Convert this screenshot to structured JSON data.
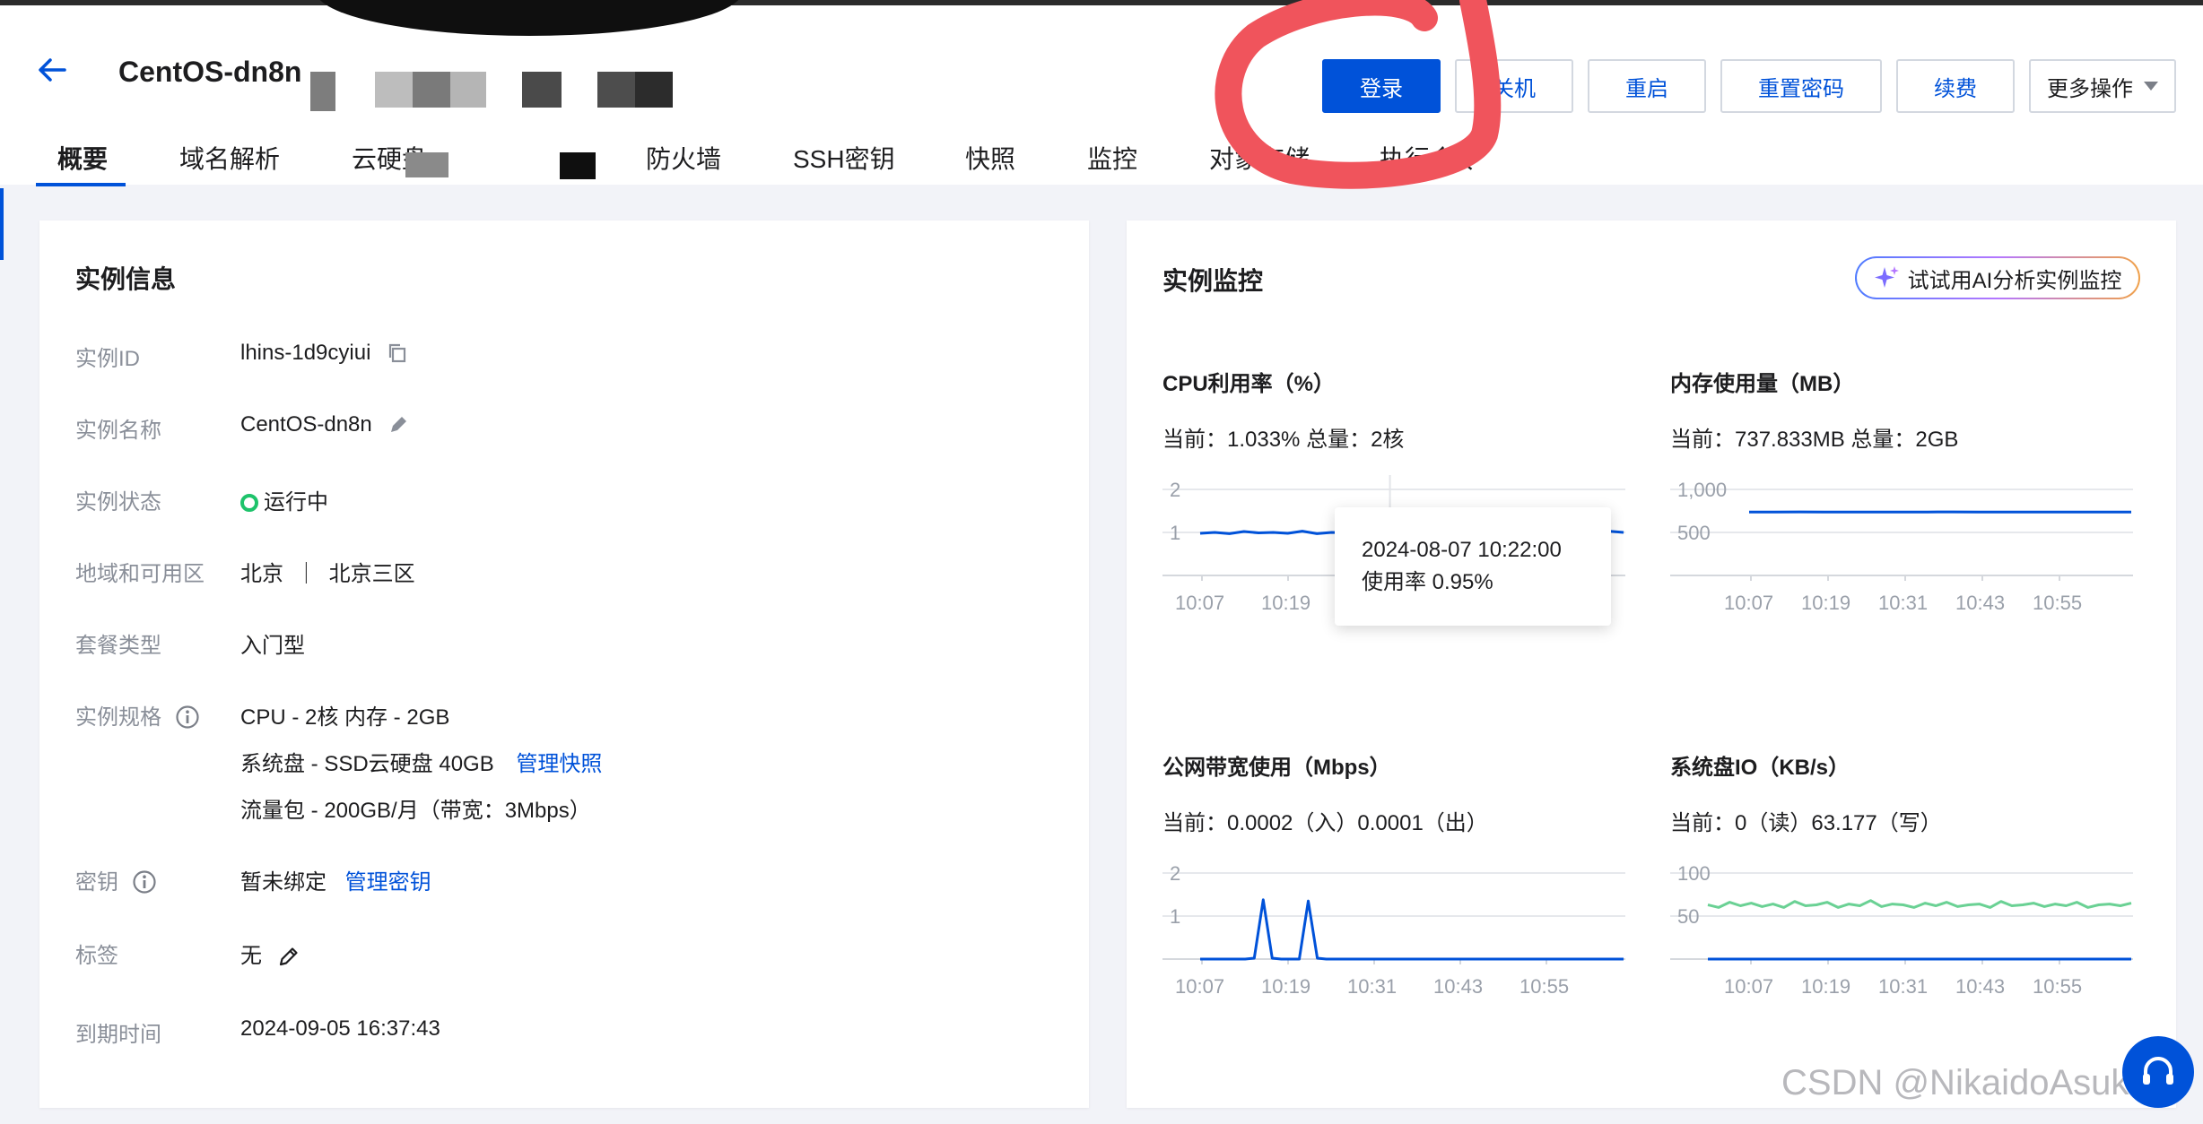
{
  "header": {
    "title": "CentOS-dn8n",
    "buttons": {
      "login": "登录",
      "shutdown": "关机",
      "restart": "重启",
      "reset_password": "重置密码",
      "renew": "续费",
      "more": "更多操作"
    }
  },
  "tabs": [
    {
      "label": "概要"
    },
    {
      "label": "域名解析"
    },
    {
      "label": "云硬盘"
    },
    {
      "label": "防火墙"
    },
    {
      "label": "SSH密钥"
    },
    {
      "label": "快照"
    },
    {
      "label": "监控"
    },
    {
      "label": "对象存储"
    },
    {
      "label": "执行命令"
    }
  ],
  "instance_info": {
    "title": "实例信息",
    "id_label": "实例ID",
    "id_value": "lhins-1d9cyiui",
    "name_label": "实例名称",
    "name_value": "CentOS-dn8n",
    "status_label": "实例状态",
    "status_value": "运行中",
    "region_label": "地域和可用区",
    "region_value": "北京  ｜  北京三区",
    "package_label": "套餐类型",
    "package_value": "入门型",
    "spec_label": "实例规格",
    "spec_cpu": "CPU - 2核 内存 - 2GB",
    "spec_disk": "系统盘 - SSD云硬盘 40GB",
    "spec_disk_link": "管理快照",
    "spec_traffic": "流量包 - 200GB/月（带宽：3Mbps）",
    "key_label": "密钥",
    "key_value": "暂未绑定",
    "key_link": "管理密钥",
    "tag_label": "标签",
    "tag_value": "无",
    "expire_label": "到期时间",
    "expire_value": "2024-09-05 16:37:43"
  },
  "monitor": {
    "title": "实例监控",
    "ai_button": "试试用AI分析实例监控",
    "tooltip_time": "2024-08-07 10:22:00",
    "tooltip_value": "使用率 0.95%",
    "charts": [
      {
        "title": "CPU利用率（%）",
        "current": "当前：1.033% 总量：2核"
      },
      {
        "title": "内存使用量（MB）",
        "current": "当前：737.833MB 总量：2GB"
      },
      {
        "title": "公网带宽使用（Mbps）",
        "current": "当前：0.0002（入）0.0001（出）"
      },
      {
        "title": "系统盘IO（KB/s）",
        "current": "当前：0（读）63.177（写）"
      }
    ]
  },
  "watermark": "CSDN @NikaidoAsuka",
  "colors": {
    "primary": "#0052d9",
    "running": "#1ec36b",
    "io_write": "#6ad194",
    "scribble": "#f0545c"
  },
  "chart_data": [
    {
      "type": "line",
      "yticks": [
        "2",
        "1"
      ],
      "ylim": [
        0,
        2
      ],
      "x_ticks": [
        "10:07",
        "10:19",
        "10:31",
        "10:43",
        "10:55"
      ],
      "series": [
        {
          "values": [
            0.98,
            1.0,
            0.97,
            1.02,
            0.99,
            1.0,
            0.98,
            1.03,
            0.97,
            1.0,
            0.99,
            1.02,
            0.98,
            0.95,
            0.99,
            0.98,
            1.01,
            0.97,
            1.0,
            0.99,
            1.02,
            0.98,
            1.0,
            0.99,
            1.01,
            0.98,
            1.0,
            0.99,
            1.03,
            1.0
          ]
        }
      ]
    },
    {
      "type": "line",
      "yticks": [
        "1,000",
        "500"
      ],
      "ylim": [
        0,
        1000
      ],
      "x_ticks": [
        "10:07",
        "10:19",
        "10:31",
        "10:43",
        "10:55"
      ],
      "series": [
        {
          "values": [
            738,
            738,
            739,
            738,
            738,
            737,
            738,
            738,
            739,
            738,
            738,
            738,
            737,
            738,
            738,
            738
          ]
        }
      ]
    },
    {
      "type": "line",
      "yticks": [
        "2",
        "1"
      ],
      "ylim": [
        0,
        2
      ],
      "x_ticks": [
        "10:07",
        "10:19",
        "10:31",
        "10:43",
        "10:55"
      ],
      "series": [
        {
          "values": [
            0,
            0,
            0,
            0,
            0,
            0,
            0.02,
            1.38,
            0.02,
            0,
            0,
            0,
            1.35,
            0.02,
            0,
            0,
            0,
            0,
            0,
            0,
            0,
            0,
            0,
            0,
            0,
            0,
            0,
            0,
            0,
            0,
            0,
            0,
            0,
            0,
            0,
            0,
            0,
            0,
            0,
            0,
            0,
            0,
            0,
            0,
            0,
            0,
            0,
            0
          ]
        }
      ]
    },
    {
      "type": "line",
      "yticks": [
        "100",
        "50"
      ],
      "ylim": [
        0,
        100
      ],
      "x_ticks": [
        "10:07",
        "10:19",
        "10:31",
        "10:43",
        "10:55"
      ],
      "series": [
        {
          "values": [
            63,
            60,
            66,
            62,
            65,
            61,
            64,
            60,
            67,
            62,
            63,
            66,
            60,
            64,
            62,
            68,
            61,
            64,
            63,
            60,
            65,
            62,
            66,
            61,
            63,
            64,
            60,
            67,
            62,
            63,
            65,
            61,
            64,
            62,
            66,
            60,
            63,
            64,
            62,
            65
          ]
        },
        {
          "values": [
            0,
            0,
            0,
            0,
            0,
            0,
            0,
            0,
            0,
            0,
            0,
            0
          ]
        }
      ]
    }
  ]
}
